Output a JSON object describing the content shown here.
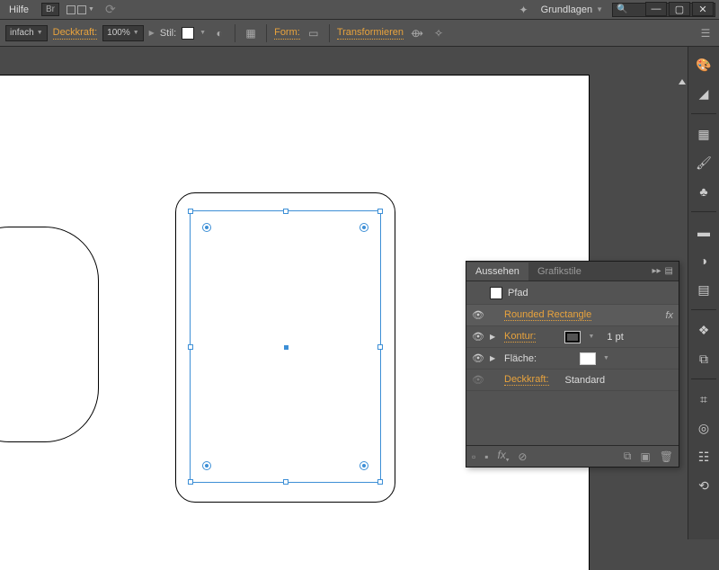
{
  "titlebar": {
    "help": "Hilfe",
    "br": "Br",
    "workspace": "Grundlagen"
  },
  "controlbar": {
    "mode": "infach",
    "opacity_label": "Deckkraft:",
    "opacity_value": "100%",
    "style_label": "Stil:",
    "shape_label": "Form:",
    "transform_label": "Transformieren"
  },
  "panel": {
    "tabs": {
      "appearance": "Aussehen",
      "graphic_styles": "Grafikstile"
    },
    "path_label": "Pfad",
    "effect_name": "Rounded Rectangle",
    "fx_badge": "fx",
    "stroke_label": "Kontur:",
    "stroke_value": "1 pt",
    "fill_label": "Fläche:",
    "opacity_label": "Deckkraft:",
    "opacity_value": "Standard"
  },
  "dock_icons": [
    "color",
    "swatches",
    "grid",
    "brushes",
    "symbols",
    "stroke",
    "appearance",
    "layers",
    "pathfinder",
    "artboards",
    "align",
    "actions"
  ]
}
